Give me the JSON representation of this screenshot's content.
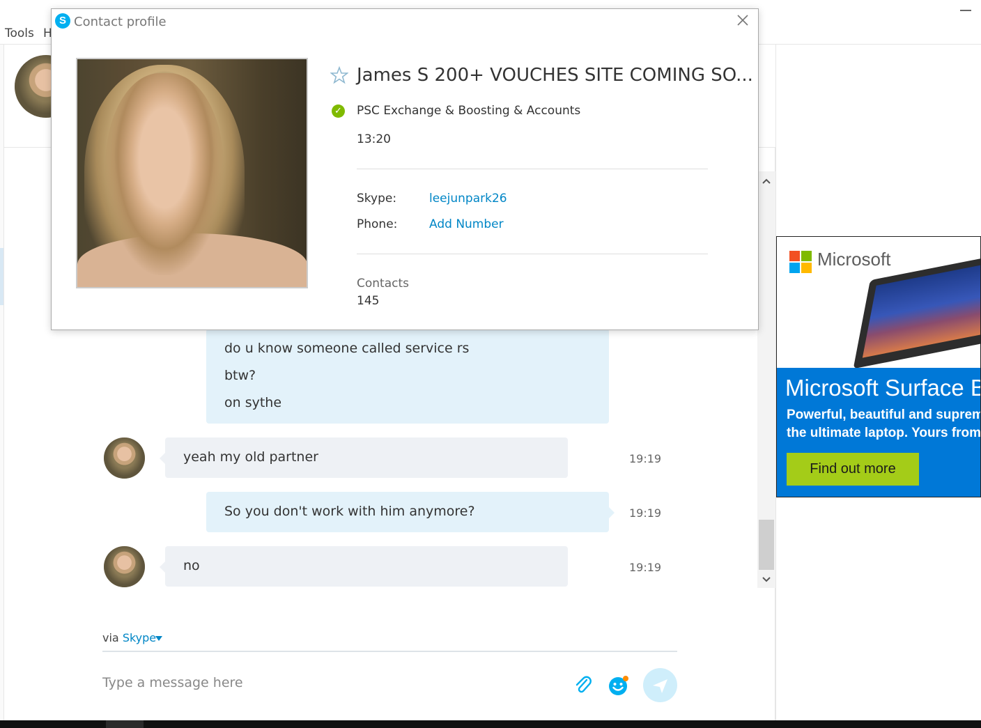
{
  "menubar": {
    "items": [
      "Tools",
      "H"
    ]
  },
  "dialog": {
    "title": "Contact profile",
    "close_glyph": "✕",
    "name": "James S 200+ VOUCHES SITE COMING SO...",
    "mood": "PSC Exchange & Boosting & Accounts",
    "local_time": "13:20",
    "skype_label": "Skype:",
    "skype_value": "leejunpark26",
    "phone_label": "Phone:",
    "phone_value": "Add Number",
    "contacts_label": "Contacts",
    "contacts_count": "145",
    "status_color": "#7fba00"
  },
  "messages": [
    {
      "direction": "out",
      "lines": [
        "do u know someone called service rs",
        "btw?",
        "on sythe"
      ],
      "time": ""
    },
    {
      "direction": "in",
      "lines": [
        "yeah my old partner"
      ],
      "time": "19:19"
    },
    {
      "direction": "out",
      "lines": [
        "So you don't work with him anymore?"
      ],
      "time": "19:19"
    },
    {
      "direction": "in",
      "lines": [
        "no"
      ],
      "time": "19:19"
    }
  ],
  "composer": {
    "via_prefix": "via",
    "via_service": "Skype",
    "placeholder": "Type a message here"
  },
  "ad": {
    "brand": "Microsoft",
    "title": "Microsoft Surface B",
    "body_line1": "Powerful, beautiful and supreme",
    "body_line2": "the ultimate laptop. Yours from",
    "cta": "Find out more",
    "brand_colors": [
      "#f25022",
      "#7fba00",
      "#00a4ef",
      "#ffb900"
    ],
    "accent": "#0078d7",
    "cta_color": "#a4cc18"
  },
  "icons": {
    "attach": "paperclip-icon",
    "emoticon": "emoticon-icon",
    "send": "send-icon",
    "favorite": "star-icon",
    "status": "online-status-icon"
  },
  "colors": {
    "skype_blue": "#00aff0",
    "link_blue": "#0086c6",
    "outgoing_bubble": "#e3f2fa",
    "incoming_bubble": "#eef1f5"
  }
}
